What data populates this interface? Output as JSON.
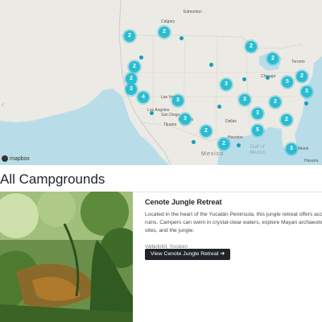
{
  "map": {
    "attribution": "mapbox",
    "country_label": "Mexico",
    "water_labels": {
      "gulf": "Gulf of\nMexico",
      "cut": "c"
    },
    "place_labels": [
      "Calgary",
      "Edmonton",
      "Las Vegas",
      "Los Angeles",
      "Phoenix",
      "Dallas",
      "Houston",
      "Chicago",
      "Toronto",
      "Miami",
      "San Diego",
      "Tijuana",
      "Havana"
    ],
    "clusters": [
      {
        "count": "2"
      },
      {
        "count": "2"
      },
      {
        "count": "2"
      },
      {
        "count": "2"
      },
      {
        "count": "3"
      },
      {
        "count": "4"
      },
      {
        "count": "3"
      },
      {
        "count": "3"
      },
      {
        "count": "2"
      },
      {
        "count": "2"
      },
      {
        "count": "3"
      },
      {
        "count": "3"
      },
      {
        "count": "3"
      },
      {
        "count": "5"
      },
      {
        "count": "2"
      },
      {
        "count": "2"
      },
      {
        "count": "2"
      },
      {
        "count": "5"
      },
      {
        "count": "2"
      },
      {
        "count": "3"
      },
      {
        "count": "2"
      },
      {
        "count": "3"
      }
    ],
    "cluster_color": "#2bbcd1"
  },
  "page": {
    "heading": "All Campgrounds"
  },
  "campground": {
    "title": "Cenote Jungle Retreat",
    "description": "Located in the heart of the Yucatán Peninsula, this jungle retreat offers access to ruins. Campers can swim in crystal-clear waters, explore Mayan archaeological sites, and the jungle.",
    "location": "Valladolid, Yucatan",
    "button_label": "View Cenote Jungle Retreat",
    "button_icon": "arrow-right-icon"
  }
}
